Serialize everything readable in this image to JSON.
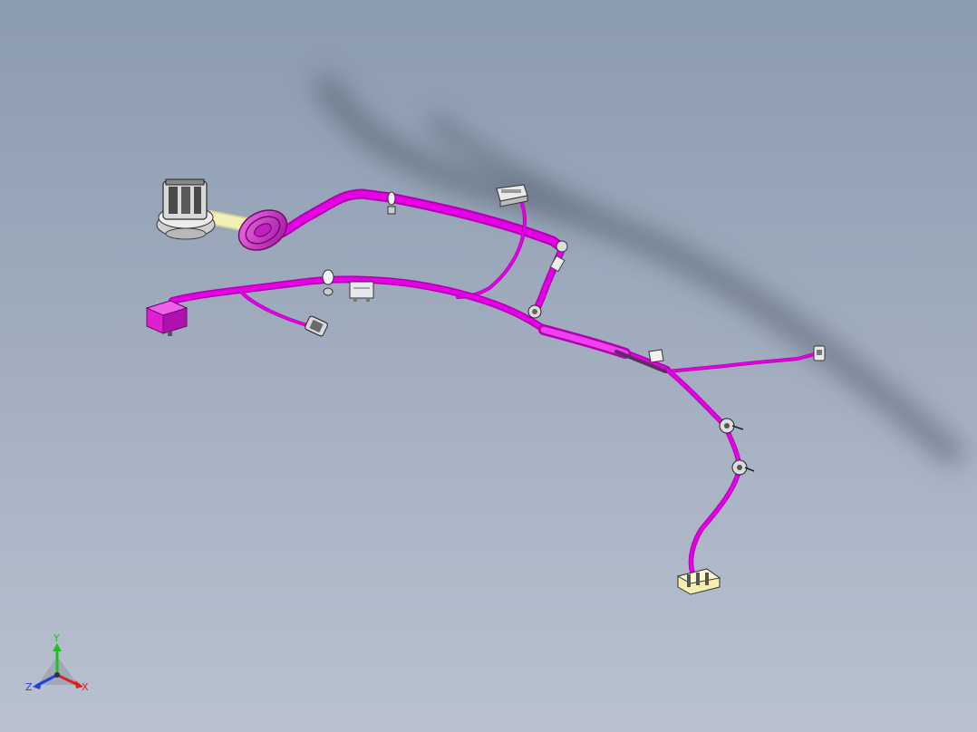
{
  "viewport": {
    "background_top": "#8b9bb0",
    "background_bottom": "#b9c1cf"
  },
  "harness": {
    "wire_color": "#e600e6",
    "wire_shade": "#b000b0",
    "grommet_color": "#e040d8",
    "tape_color": "#f2f0b4",
    "connector_color": "#e6e6ea",
    "yellow_connector_color": "#f4efb0",
    "magenta_block_color": "#e020d0"
  },
  "triad": {
    "x_label": "X",
    "y_label": "Y",
    "z_label": "Z",
    "x_color": "#e02020",
    "y_color": "#20c020",
    "z_color": "#2040e0"
  },
  "components": [
    {
      "name": "round-multi-pin-connector",
      "kind": "connector"
    },
    {
      "name": "rubber-grommet",
      "kind": "grommet"
    },
    {
      "name": "flat-connector-top",
      "kind": "connector"
    },
    {
      "name": "magenta-terminal-block",
      "kind": "connector"
    },
    {
      "name": "small-plug-connector",
      "kind": "connector"
    },
    {
      "name": "mini-relay-connector",
      "kind": "connector"
    },
    {
      "name": "branch-end-connector",
      "kind": "connector"
    },
    {
      "name": "inline-tag-connector",
      "kind": "connector"
    },
    {
      "name": "yellow-end-connector",
      "kind": "connector"
    }
  ]
}
